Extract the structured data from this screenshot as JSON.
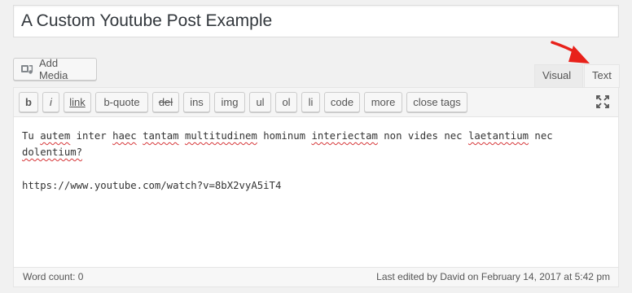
{
  "post_title": "A Custom Youtube Post Example",
  "media": {
    "add_media_label": "Add Media"
  },
  "tabs": {
    "visual": "Visual",
    "text": "Text"
  },
  "quicktags": [
    "b",
    "i",
    "link",
    "b-quote",
    "del",
    "ins",
    "img",
    "ul",
    "ol",
    "li",
    "code",
    "more",
    "close tags"
  ],
  "content": {
    "line1_words": [
      "Tu",
      "autem",
      "inter",
      "haec",
      "tantam",
      "multitudinem",
      "hominum",
      "interiectam",
      "non",
      "vides",
      "nec",
      "laetantium",
      "nec",
      "dolentium?"
    ],
    "line2": "https://www.youtube.com/watch?v=8bX2vyA5iT4"
  },
  "status": {
    "word_count": "Word count: 0",
    "last_edited": "Last edited by David on February 14, 2017 at 5:42 pm"
  },
  "colors": {
    "annotation_arrow": "#e8211a",
    "spellcheck": "#d63638"
  }
}
